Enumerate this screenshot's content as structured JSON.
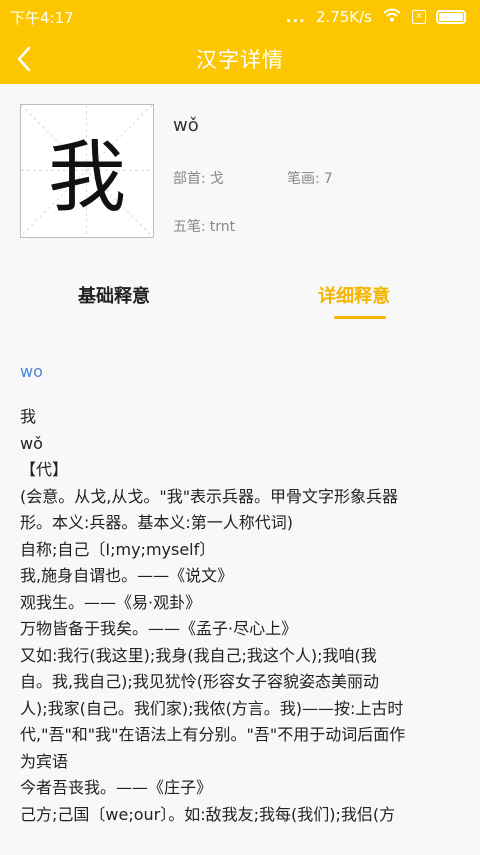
{
  "status": {
    "time": "下午4:17",
    "signal_dots": "...",
    "speed": "2.75K/s",
    "sim_label": "x"
  },
  "nav": {
    "title": "汉字详情",
    "back_icon": "chevron-left-icon"
  },
  "character": {
    "glyph": "我",
    "pinyin": "wǒ",
    "radical_label": "部首:",
    "radical": "戈",
    "strokes_label": "笔画:",
    "strokes": "7",
    "wubi_label": "五笔:",
    "wubi": "trnt"
  },
  "tabs": [
    {
      "label": "基础释意",
      "active": false
    },
    {
      "label": "详细释意",
      "active": true
    }
  ],
  "detail": {
    "link": "wo",
    "lines": [
      "我",
      "wǒ",
      "【代】",
      "(会意。从戈,从戈。\"我\"表示兵器。甲骨文字形象兵器",
      "形。本义:兵器。基本义:第一人称代词)",
      "自称;自己〔I;my;myself〕",
      "我,施身自谓也。——《说文》",
      "观我生。——《易·观卦》",
      "万物皆备于我矣。——《孟子·尽心上》",
      "又如:我行(我这里);我身(我自己;我这个人);我咱(我",
      "自。我,我自己);我见犹怜(形容女子容貌姿态美丽动",
      "人);我家(自己。我们家);我侬(方言。我)——按:上古时",
      "代,\"吾\"和\"我\"在语法上有分别。\"吾\"不用于动词后面作",
      "为宾语",
      "今者吾丧我。——《庄子》",
      "己方;己国〔we;our〕。如:敌我友;我每(我们);我侣(方"
    ]
  },
  "colors": {
    "accent": "#fcc700",
    "tab_active": "#f4b400",
    "link": "#4a86d8"
  }
}
